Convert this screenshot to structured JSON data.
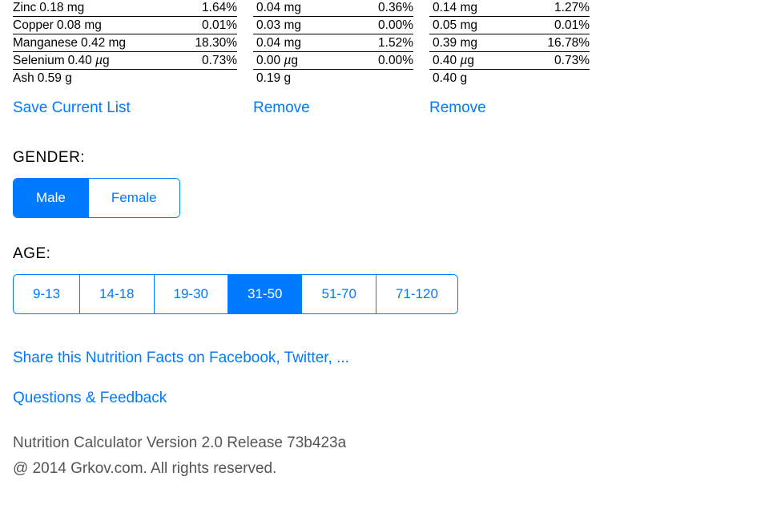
{
  "colors": {
    "accent": "#007aff"
  },
  "nutrition": {
    "col1": {
      "rows": [
        {
          "label": "Zinc",
          "value": "0.18 mg",
          "pct": "1.64%"
        },
        {
          "label": "Copper",
          "value": "0.08 mg",
          "pct": "0.01%"
        },
        {
          "label": "Manganese",
          "value": "0.42 mg",
          "pct": "18.30%"
        },
        {
          "label": "Selenium",
          "value": "0.40 µg",
          "pct": "0.73%"
        }
      ],
      "ash": {
        "label": "Ash",
        "value": "0.59 g"
      },
      "action": "Save Current List"
    },
    "col2": {
      "rows": [
        {
          "value": "0.04 mg",
          "pct": "0.36%"
        },
        {
          "value": "0.03 mg",
          "pct": "0.00%"
        },
        {
          "value": "0.04 mg",
          "pct": "1.52%"
        },
        {
          "value": "0.00 µg",
          "pct": "0.00%"
        }
      ],
      "ash": {
        "value": "0.19 g"
      },
      "action": "Remove"
    },
    "col3": {
      "rows": [
        {
          "value": "0.14 mg",
          "pct": "1.27%"
        },
        {
          "value": "0.05 mg",
          "pct": "0.01%"
        },
        {
          "value": "0.39 mg",
          "pct": "16.78%"
        },
        {
          "value": "0.40 µg",
          "pct": "0.73%"
        }
      ],
      "ash": {
        "value": "0.40 g"
      },
      "action": "Remove"
    }
  },
  "gender": {
    "label": "GENDER:",
    "options": [
      "Male",
      "Female"
    ],
    "selected": 0
  },
  "age": {
    "label": "AGE:",
    "options": [
      "9-13",
      "14-18",
      "19-30",
      "31-50",
      "51-70",
      "71-120"
    ],
    "selected": 3
  },
  "links": {
    "share": "Share this Nutrition Facts on Facebook, Twitter, ...",
    "feedback": "Questions & Feedback"
  },
  "footer": {
    "version": "Nutrition Calculator Version 2.0 Release 73b423a",
    "copyright": "@ 2014 Grkov.com. All rights reserved."
  }
}
